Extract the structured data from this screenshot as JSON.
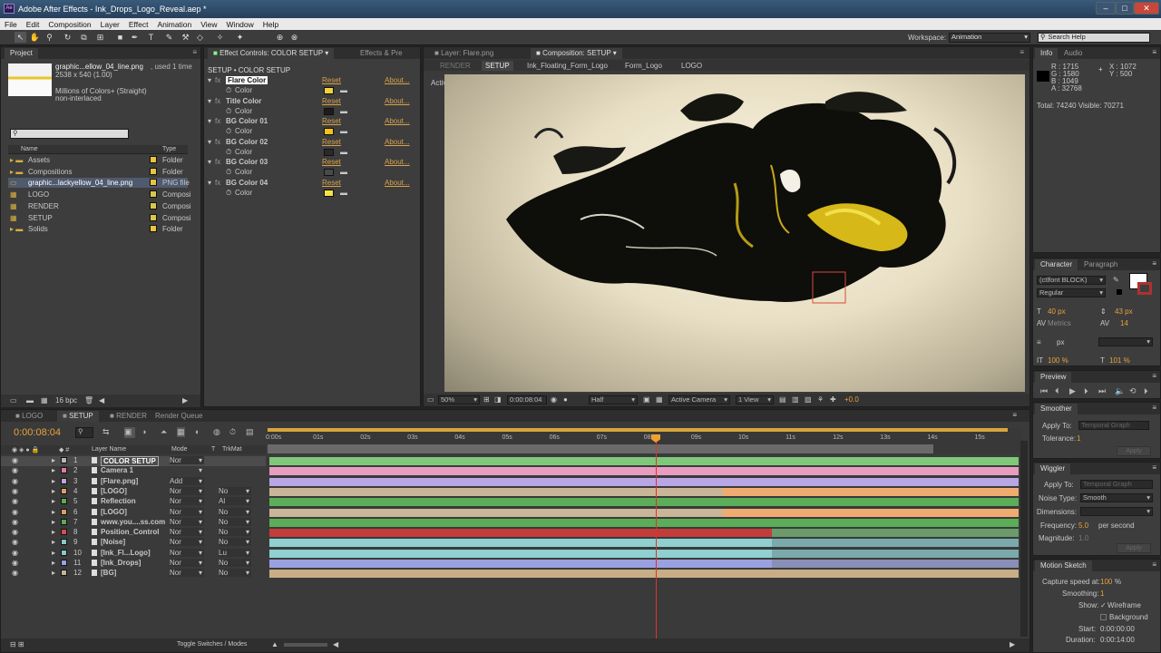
{
  "window": {
    "title": "Adobe After Effects - Ink_Drops_Logo_Reveal.aep *",
    "app_icon": "Ae",
    "controls": [
      "–",
      "□",
      "✕"
    ]
  },
  "menu": [
    "File",
    "Edit",
    "Composition",
    "Layer",
    "Effect",
    "Animation",
    "View",
    "Window",
    "Help"
  ],
  "toolbar": {
    "workspace_label": "Workspace:",
    "workspace_value": "Animation",
    "search_placeholder": "Search Help"
  },
  "project": {
    "tab": "Project",
    "file_name": "graphic...ellow_04_line.png",
    "used": ", used 1 time",
    "dims": "2538 x 540 (1.00)",
    "colors": "Millions of Colors+ (Straight)",
    "interlace": "non-interlaced",
    "col_name": "Name",
    "col_type": "Type",
    "items": [
      {
        "name": "Assets",
        "type": "Folder",
        "kind": "folder"
      },
      {
        "name": "Compositions",
        "type": "Folder",
        "kind": "folder"
      },
      {
        "name": "graphic...lackyellow_04_line.png",
        "type": "PNG file",
        "kind": "file"
      },
      {
        "name": "LOGO",
        "type": "Composi",
        "kind": "comp"
      },
      {
        "name": "RENDER",
        "type": "Composi",
        "kind": "comp"
      },
      {
        "name": "SETUP",
        "type": "Composi",
        "kind": "comp"
      },
      {
        "name": "Solids",
        "type": "Folder",
        "kind": "folder"
      }
    ],
    "bpc": "16 bpc"
  },
  "effects": {
    "tab": "Effect Controls: COLOR SETUP",
    "tab2": "Effects & Pre",
    "breadcrumb": "SETUP • COLOR SETUP",
    "reset": "Reset",
    "about": "About...",
    "color_label": "Color",
    "items": [
      {
        "name": "Flare Color",
        "color": "#f2d23a"
      },
      {
        "name": "Title Color",
        "color": "#1c1c1c"
      },
      {
        "name": "BG Color 01",
        "color": "#f4c21a"
      },
      {
        "name": "BG Color 02",
        "color": "#2a2a2a"
      },
      {
        "name": "BG Color 03",
        "color": "#4a4a4a"
      },
      {
        "name": "BG Color 04",
        "color": "#f2e34a"
      }
    ]
  },
  "comp": {
    "tab_layer": "Layer: Flare.png",
    "tab_comp": "Composition: SETUP",
    "crumbs": [
      "RENDER",
      "SETUP",
      "Ink_Floating_Form_Logo",
      "Form_Logo",
      "LOGO"
    ],
    "camera": "Active Camera",
    "zoom": "50%",
    "time": "0:00:08:04",
    "res": "Half",
    "cam_select": "Active Camera",
    "views": "1 View",
    "exposure": "+0.0"
  },
  "info": {
    "tab": "Info",
    "tab2": "Audio",
    "r": "R : 1715",
    "g": "G : 1580",
    "b": "B : 1049",
    "a": "A : 32768",
    "x": "X : 1072",
    "y": "Y : 500",
    "total": "Total: 74240  Visible: 70271"
  },
  "character": {
    "tab": "Character",
    "tab2": "Paragraph",
    "font": "(ctlfont BLOCK)",
    "style": "Regular",
    "size": "40 px",
    "leading": "43 px",
    "kerning": "Metrics",
    "tracking": "14",
    "stroke": "px",
    "vscale": "100 %",
    "hscale": "101 %"
  },
  "preview": {
    "tab": "Preview"
  },
  "smoother": {
    "tab": "Smoother",
    "apply_label": "Apply To:",
    "apply_value": "Temporal Graph",
    "tol_label": "Tolerance:",
    "tol_value": "1",
    "apply_btn": "Apply"
  },
  "wiggler": {
    "tab": "Wiggler",
    "apply_label": "Apply To:",
    "apply_value": "Temporal Graph",
    "noise_label": "Noise Type:",
    "noise_value": "Smooth",
    "dim_label": "Dimensions:",
    "freq_label": "Frequency:",
    "freq_value": "5.0",
    "freq_unit": "per second",
    "mag_label": "Magnitude:",
    "mag_value": "1.0",
    "apply_btn": "Apply"
  },
  "motion_sketch": {
    "tab": "Motion Sketch",
    "capture_label": "Capture speed at:",
    "capture_value": "100",
    "capture_unit": "%",
    "smooth_label": "Smoothing:",
    "smooth_value": "1",
    "show_label": "Show:",
    "wireframe": "Wireframe",
    "background": "Background",
    "start_label": "Start:",
    "start_value": "0:00:00:00",
    "dur_label": "Duration:",
    "dur_value": "0:00:14:00"
  },
  "timeline": {
    "tabs": [
      "LOGO",
      "SETUP",
      "RENDER",
      "Render Queue"
    ],
    "time": "0:00:08:04",
    "col_layer": "Layer Name",
    "col_mode": "Mode",
    "col_t": "T",
    "col_trk": "TrkMat",
    "ruler": [
      "0:00s",
      "01s",
      "02s",
      "03s",
      "04s",
      "05s",
      "06s",
      "07s",
      "08s",
      "09s",
      "10s",
      "11s",
      "12s",
      "13s",
      "14s",
      "15s"
    ],
    "footer": "Toggle Switches / Modes",
    "layers": [
      {
        "num": "1",
        "name": "COLOR SETUP",
        "mode": "Nor",
        "trk": "",
        "color": "#b7b7b7",
        "bar": "#7ec87a"
      },
      {
        "num": "2",
        "name": "Camera 1",
        "mode": "",
        "trk": "",
        "color": "#d87fa0",
        "bar": "#e89cc0"
      },
      {
        "num": "3",
        "name": "[Flare.png]",
        "mode": "Add",
        "trk": "",
        "color": "#c0a4e0",
        "bar": "#b9a6e4"
      },
      {
        "num": "4",
        "name": "[LOGO]",
        "mode": "Nor",
        "trk": "No",
        "color": "#d4a068",
        "bar": "#f0ac70"
      },
      {
        "num": "5",
        "name": "Reflection",
        "mode": "Nor",
        "trk": "Al",
        "color": "#5ca85a",
        "bar": "#5cad58"
      },
      {
        "num": "6",
        "name": "[LOGO]",
        "mode": "Nor",
        "trk": "No",
        "color": "#d4a068",
        "bar": "#f0ac70"
      },
      {
        "num": "7",
        "name": "www.you....ss.com",
        "mode": "Nor",
        "trk": "No",
        "color": "#5ca85a",
        "bar": "#5cad58"
      },
      {
        "num": "8",
        "name": "Position_Control",
        "mode": "Nor",
        "trk": "No",
        "color": "#d05050",
        "bar": "#c33c3c"
      },
      {
        "num": "9",
        "name": "[Noise]",
        "mode": "Nor",
        "trk": "No",
        "color": "#88c8c8",
        "bar": "#8fd0d0"
      },
      {
        "num": "10",
        "name": "[Ink_Fl...Logo]",
        "mode": "Nor",
        "trk": "Lu",
        "color": "#88c8c8",
        "bar": "#8fd0d0"
      },
      {
        "num": "11",
        "name": "[Ink_Drops]",
        "mode": "Nor",
        "trk": "No",
        "color": "#9aa0e0",
        "bar": "#9aa0e0"
      },
      {
        "num": "12",
        "name": "[BG]",
        "mode": "Nor",
        "trk": "No",
        "color": "#c8b090",
        "bar": "#c8ad86"
      }
    ]
  }
}
